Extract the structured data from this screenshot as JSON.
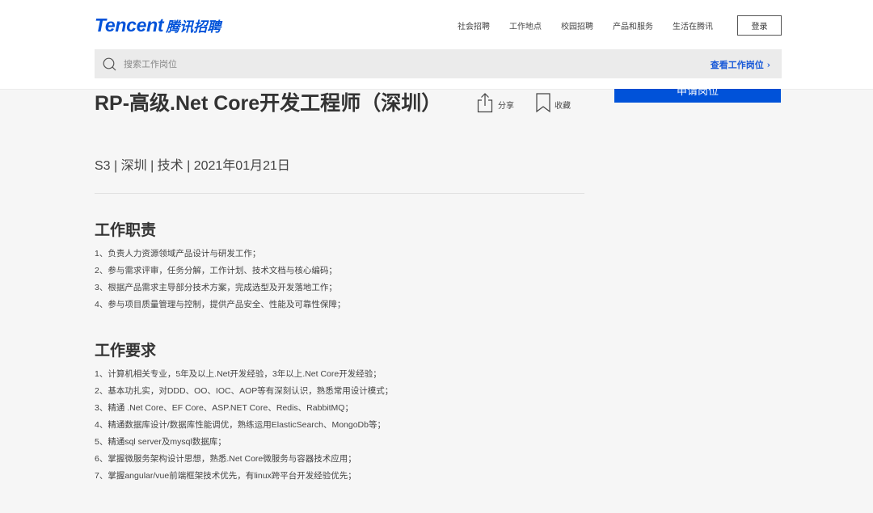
{
  "header": {
    "logo_en": "Tencent",
    "logo_cn": "腾讯招聘",
    "nav": [
      "社会招聘",
      "工作地点",
      "校园招聘",
      "产品和服务",
      "生活在腾讯"
    ],
    "login_label": "登录"
  },
  "search": {
    "placeholder": "搜索工作岗位",
    "view_jobs_label": "查看工作岗位 ›"
  },
  "apply_label": "申请岗位",
  "job": {
    "title": "RP-高级.Net Core开发工程师（深圳）",
    "share_label": "分享",
    "favorite_label": "收藏",
    "meta": "S3 | 深圳 | 技术 | 2021年01月21日"
  },
  "duties": {
    "title": "工作职责",
    "items": [
      "1、负责人力资源领域产品设计与研发工作；",
      "2、参与需求评审，任务分解，工作计划、技术文档与核心编码；",
      "3、根据产品需求主导部分技术方案，完成选型及开发落地工作；",
      "4、参与项目质量管理与控制，提供产品安全、性能及可靠性保障；"
    ]
  },
  "requirements": {
    "title": "工作要求",
    "items": [
      "1、计算机相关专业，5年及以上.Net开发经验，3年以上.Net Core开发经验；",
      "2、基本功扎实，对DDD、OO、IOC、AOP等有深刻认识，熟悉常用设计模式；",
      "3、精通 .Net Core、EF Core、ASP.NET Core、Redis、RabbitMQ；",
      "4、精通数据库设计/数据库性能调优，熟练运用ElasticSearch、MongoDb等；",
      "5、精通sql server及mysql数据库；",
      "6、掌握微服务架构设计思想，熟悉.Net Core微服务与容器技术应用；",
      "7、掌握angular/vue前端框架技术优先，有linux跨平台开发经验优先；"
    ]
  },
  "colors": {
    "brand": "#0052d9",
    "link": "#1859d8",
    "background": "#f6f6f6"
  }
}
